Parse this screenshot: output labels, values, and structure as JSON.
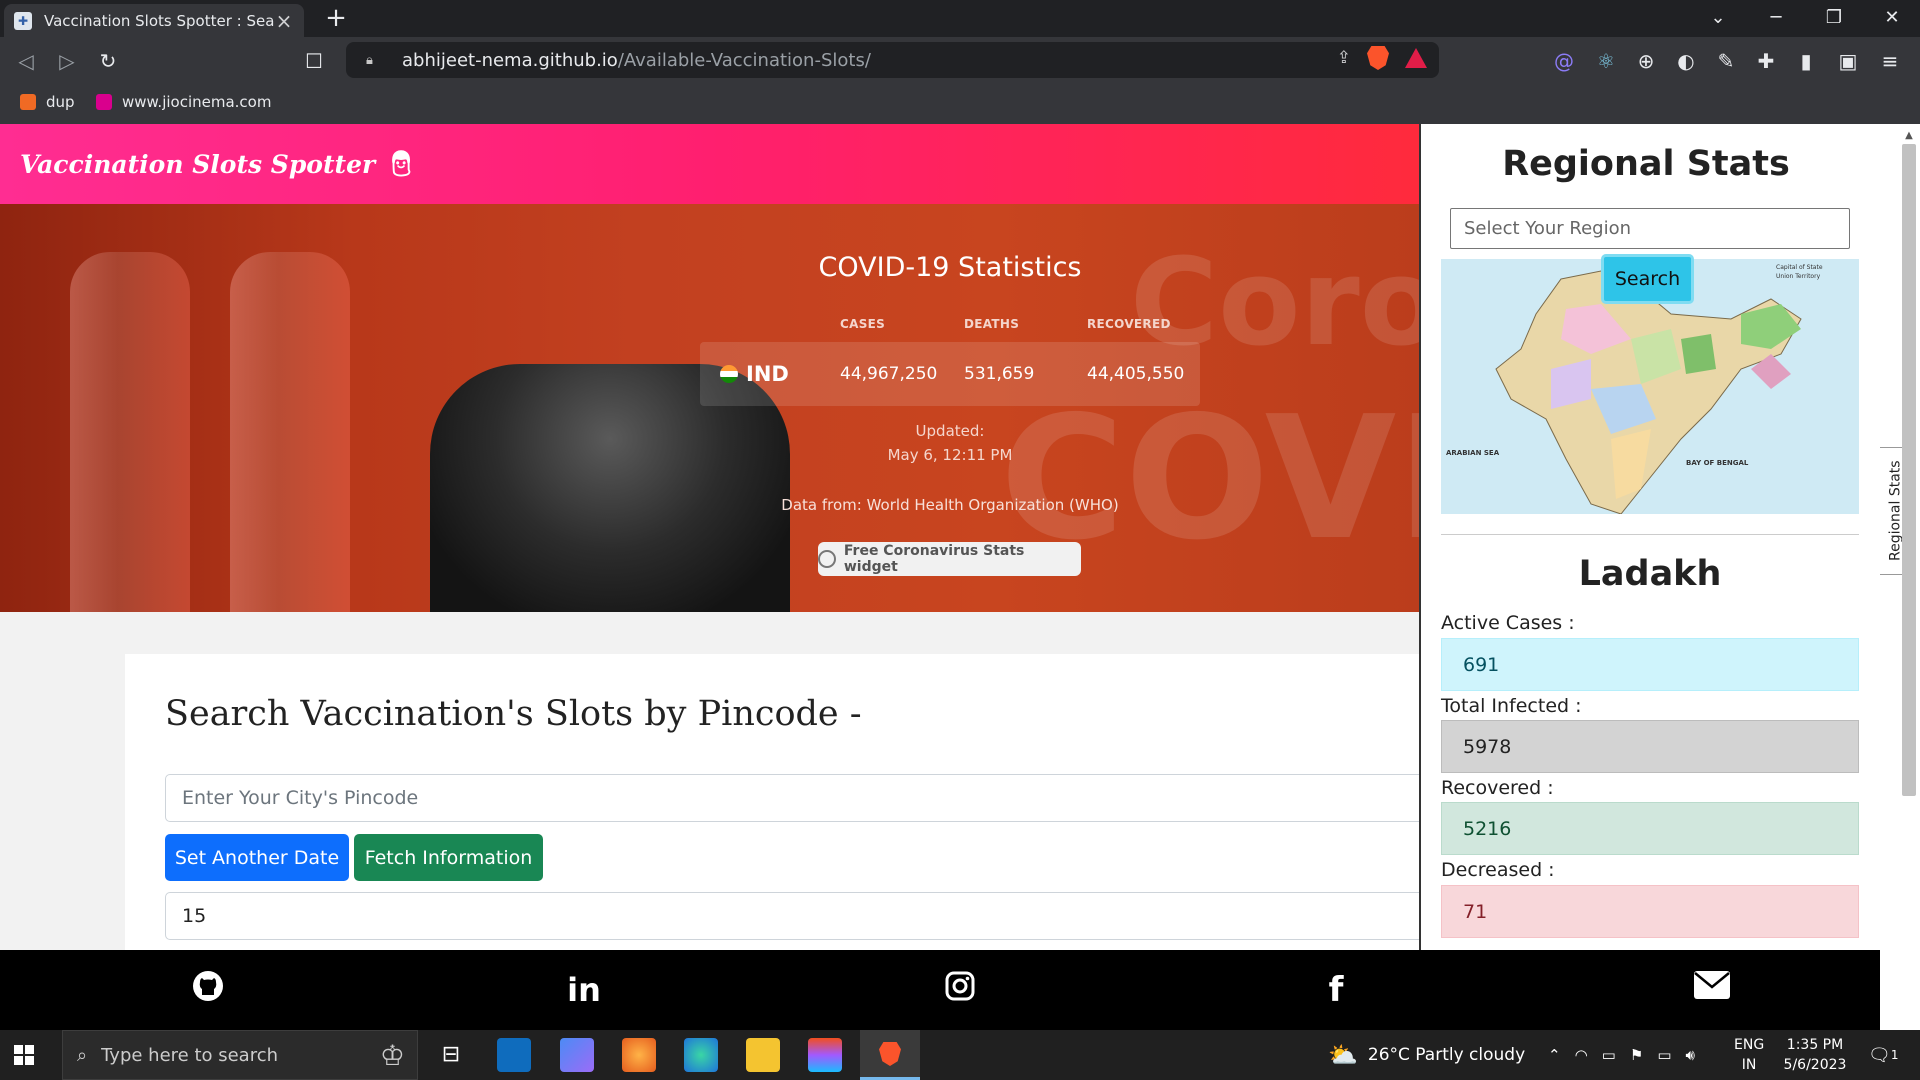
{
  "browser": {
    "tab_title": "Vaccination Slots Spotter : Search",
    "url_host": "abhijeet-nema.github.io",
    "url_path": "/Available-Vaccination-Slots/",
    "bookmarks": [
      {
        "label": "dup",
        "icon": "dup-favicon",
        "color": "#f06a24"
      },
      {
        "label": "www.jiocinema.com",
        "icon": "jiocinema-favicon",
        "color": "#d9008d"
      }
    ]
  },
  "navbar": {
    "brand": "Vaccination Slots Spotter",
    "brand_icon": "doctor-icon",
    "gradient": [
      "#ff2d92",
      "#ff2a3c"
    ]
  },
  "covid_widget": {
    "title": "COVID-19 Statistics",
    "headers": [
      "CASES",
      "DEATHS",
      "RECOVERED"
    ],
    "country": "IND",
    "cases": "44,967,250",
    "deaths": "531,659",
    "recovered": "44,405,550",
    "updated_label": "Updated:",
    "updated_time": "May 6, 12:11 PM",
    "source": "Data from: World Health Organization (WHO)",
    "widget_button": "Free Coronavirus Stats widget",
    "background_text": [
      "Corona",
      "COVID"
    ]
  },
  "search_card": {
    "heading": "Search Vaccination's Slots by Pincode -",
    "pincode_placeholder": "Enter Your City's Pincode",
    "set_date_button": "Set Another Date",
    "fetch_button": "Fetch Information",
    "number_value": "15"
  },
  "regional": {
    "title": "Regional Stats",
    "region_placeholder": "Select Your Region",
    "search_button": "Search",
    "map_labels": {
      "bay": "BAY OF BENGAL",
      "arabian": "ARABIAN SEA",
      "legend": [
        "Capital of State",
        "Union Territory"
      ]
    },
    "state": "Ladakh",
    "active_label": "Active Cases :",
    "active_value": "691",
    "infected_label": "Total Infected :",
    "infected_value": "5978",
    "recovered_label": "Recovered :",
    "recovered_value": "5216",
    "deceased_label": "Decreased :",
    "deceased_value": "71",
    "side_tab": "Regional Stats"
  },
  "footer": {
    "icons": [
      "github-icon",
      "linkedin-icon",
      "instagram-icon",
      "facebook-icon",
      "mail-icon"
    ]
  },
  "taskbar": {
    "search_placeholder": "Type here to search",
    "weather": "26°C  Partly cloudy",
    "lang": "ENG",
    "region": "IN",
    "time": "1:35 PM",
    "date": "5/6/2023",
    "notification_count": "1"
  }
}
